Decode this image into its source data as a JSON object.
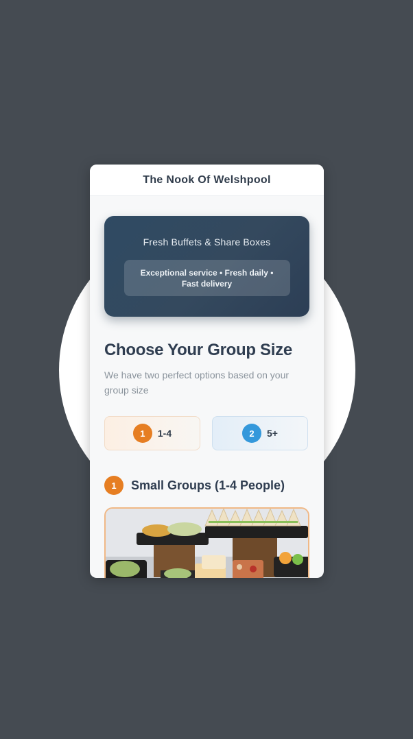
{
  "app": {
    "title": "The Nook Of Welshpool"
  },
  "hero": {
    "title": "Fresh Buffets & Share Boxes",
    "badge": "Exceptional service • Fresh daily • Fast delivery"
  },
  "section": {
    "heading": "Choose Your Group Size",
    "subtitle": "We have two perfect options based on your group size"
  },
  "options": [
    {
      "number": "1",
      "label": "1-4",
      "color": "#e67e22"
    },
    {
      "number": "2",
      "label": "5+",
      "color": "#3498db"
    }
  ],
  "group": {
    "number": "1",
    "title": "Small Groups (1-4 People)"
  },
  "colors": {
    "background": "#454b52",
    "hero": "#34495e",
    "accent_orange": "#e67e22",
    "accent_blue": "#3498db",
    "heading_text": "#2f3d50"
  }
}
